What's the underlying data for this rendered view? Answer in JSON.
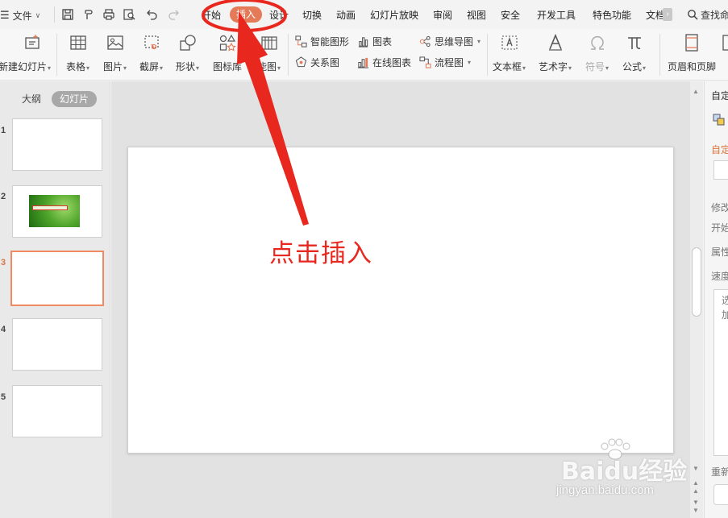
{
  "menubar": {
    "file_label": "文件",
    "tabs": [
      {
        "label": "开始"
      },
      {
        "label": "插入"
      },
      {
        "label": "设计"
      },
      {
        "label": "切换"
      },
      {
        "label": "动画"
      },
      {
        "label": "幻灯片放映"
      },
      {
        "label": "审阅"
      },
      {
        "label": "视图"
      },
      {
        "label": "安全"
      },
      {
        "label": "开发工具"
      },
      {
        "label": "特色功能"
      },
      {
        "label": "文档"
      }
    ],
    "active_tab": "插入",
    "more_symbol": "›",
    "search_label": "查找命"
  },
  "ribbon": {
    "new_slide": "新建幻灯片",
    "table": "表格",
    "picture": "图片",
    "screenshot": "截屏",
    "shape": "形状",
    "icon_lib": "图标库",
    "smart": "能图",
    "smartart": "智能图形",
    "chart": "图表",
    "relation": "关系图",
    "online_chart": "在线图表",
    "mindmap": "思维导图",
    "flowchart": "流程图",
    "textbox": "文本框",
    "wordart": "艺术字",
    "symbol": "符号",
    "formula": "公式",
    "header_footer": "页眉和页脚"
  },
  "left_pane": {
    "tab_outline": "大纲",
    "tab_slides": "幻灯片",
    "current_slide": 3,
    "slides": [
      {
        "number": "1"
      },
      {
        "number": "2"
      },
      {
        "number": "3"
      },
      {
        "number": "4"
      },
      {
        "number": "5"
      }
    ]
  },
  "right_pane": {
    "title": "自定",
    "section": "自定",
    "modify": "修改",
    "start": "开始",
    "property": "属性",
    "speed": "速度",
    "list_line1": "选",
    "list_line2": "加",
    "reorder": "重新"
  },
  "annotation": {
    "text": "点击插入",
    "color": "#e8281e"
  },
  "watermark": {
    "brand": "Baidu经验",
    "url": "jingyan.baidu.com"
  },
  "colors": {
    "active_tab": "#e47a57",
    "current_slide_border": "#f08a63",
    "annotation": "#e8281e"
  }
}
